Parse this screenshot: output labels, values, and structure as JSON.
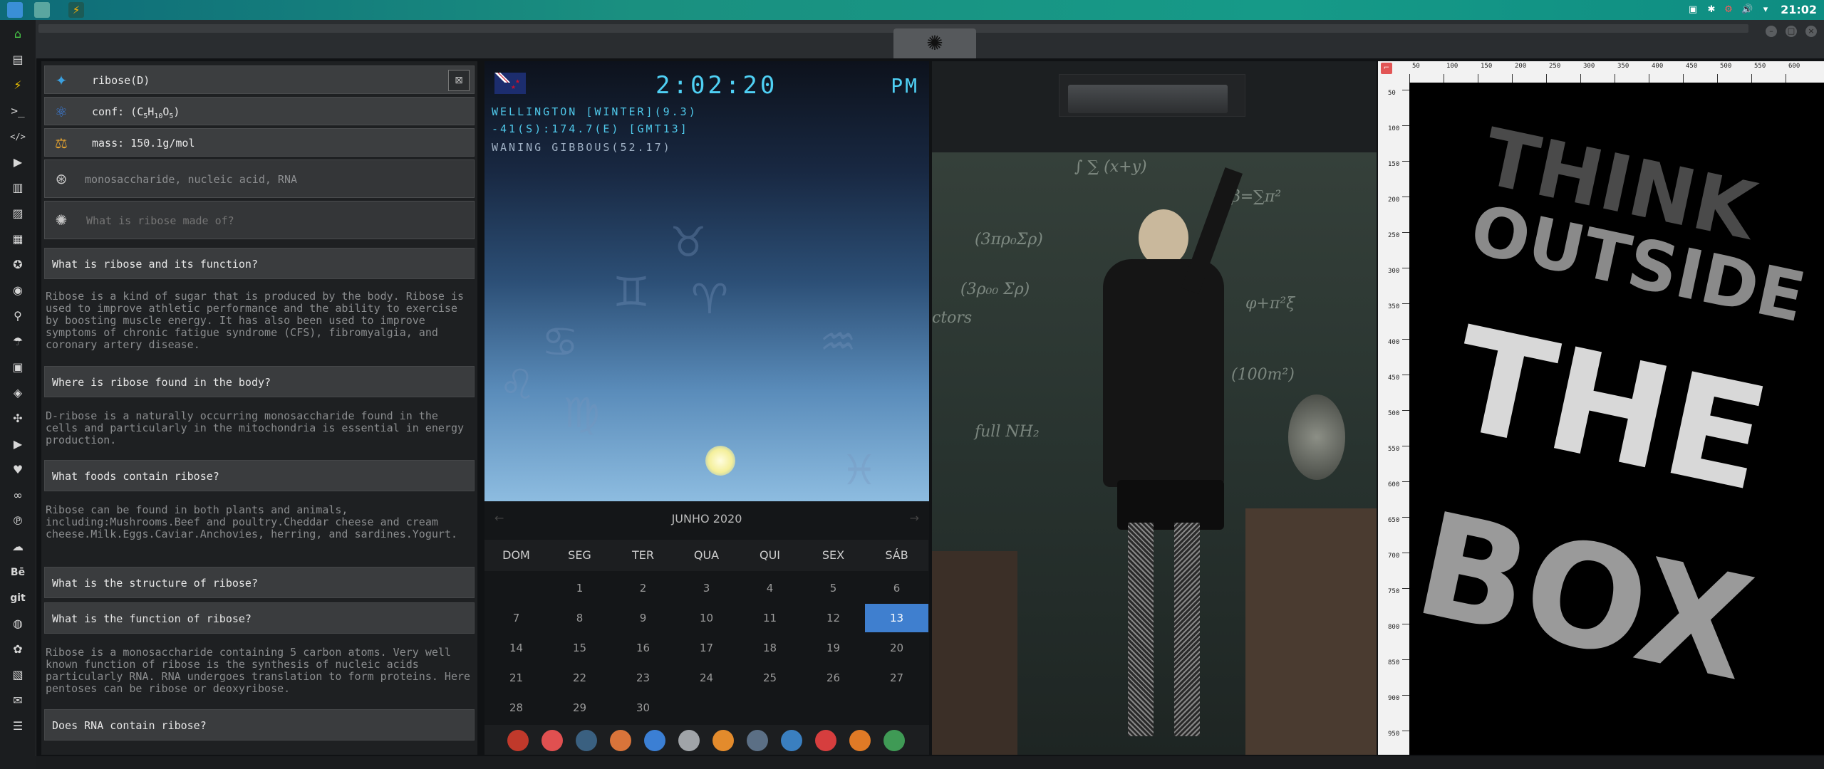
{
  "topbar": {
    "clock": "21:02",
    "apps": [
      "files-icon",
      "terminal-app-icon",
      "sublime-icon"
    ],
    "tray": [
      "screenshot-icon",
      "bluetooth-icon",
      "update-icon",
      "volume-icon",
      "wifi-icon"
    ]
  },
  "dock": {
    "items": [
      "home-icon",
      "document-icon",
      "bolt-icon",
      "terminal-icon",
      "code-icon",
      "play-icon",
      "book-icon",
      "image-icon",
      "calendar-icon",
      "compass-icon",
      "globe-icon",
      "search-icon",
      "umbrella-icon",
      "contact-icon",
      "tag-icon",
      "puzzle-icon",
      "youtube-icon",
      "heart-icon",
      "link-icon",
      "pinterest-icon",
      "cloud-icon",
      "behance-icon",
      "git-icon",
      "github-icon",
      "cube-icon",
      "map-icon",
      "mail-icon",
      "server-icon"
    ],
    "labels": {
      "behance": "Bē",
      "git": "git"
    }
  },
  "ribose": {
    "name": "ribose(D)",
    "conf": "conf: (C5H10O5)",
    "conf_parts": {
      "prefix": "conf: (C",
      "c": "5",
      "h": "H",
      "hn": "10",
      "o": "O",
      "on": "5",
      "suffix": ")"
    },
    "mass": "mass: 150.1g/mol",
    "tags": "monosaccharide, nucleic acid, RNA",
    "search_placeholder": "What is ribose made of?",
    "qa": [
      {
        "q": "What is ribose and its function?",
        "a": "Ribose is a kind of sugar that is produced by the body. Ribose is used to improve athletic performance and the ability to exercise by boosting muscle energy. It has also been used to improve symptoms of chronic fatigue syndrome (CFS), fibromyalgia, and coronary artery disease."
      },
      {
        "q": "Where is ribose found in the body?",
        "a": "D-ribose is a naturally occurring monosaccharide found in the cells and particularly in the mitochondria is essential in energy production."
      },
      {
        "q": "What foods contain ribose?",
        "a": "Ribose can be found in both plants and animals, including:Mushrooms.Beef and poultry.Cheddar cheese and cream cheese.Milk.Eggs.Caviar.Anchovies, herring, and sardines.Yogurt."
      },
      {
        "q": "What is the structure of ribose?",
        "a": ""
      },
      {
        "q": "What is the function of ribose?",
        "a": "Ribose is a monosaccharide containing 5 carbon atoms. Very well known function of ribose is the synthesis of nucleic acids particularly RNA. RNA undergoes translation to form proteins. Here pentoses can be ribose or deoxyribose."
      },
      {
        "q": "Does RNA contain ribose?",
        "a": ""
      }
    ]
  },
  "weather": {
    "time": "2:02:20",
    "ampm": "PM",
    "line1": "WELLINGTON [WINTER](9.3)",
    "line2": "-41(S):174.7(E) [GMT13]",
    "line3": "WANING GIBBOUS(52.17)"
  },
  "calendar": {
    "month": "JUNHO 2020",
    "prev": "←",
    "next": "→",
    "weekdays": [
      "DOM",
      "SEG",
      "TER",
      "QUA",
      "QUI",
      "SEX",
      "SÁB"
    ],
    "selected": "13",
    "weeks": [
      [
        "",
        "1",
        "2",
        "3",
        "4",
        "5",
        "6"
      ],
      [
        "7",
        "8",
        "9",
        "10",
        "11",
        "12",
        "13"
      ],
      [
        "14",
        "15",
        "16",
        "17",
        "18",
        "19",
        "20"
      ],
      [
        "21",
        "22",
        "23",
        "24",
        "25",
        "26",
        "27"
      ],
      [
        "28",
        "29",
        "30",
        "",
        "",
        "",
        ""
      ]
    ]
  },
  "bottomdock": {
    "apps": [
      {
        "name": "launcher-icon",
        "color": "#c0392b"
      },
      {
        "name": "hourglass-icon",
        "color": "#e05050"
      },
      {
        "name": "earth-icon",
        "color": "#3a6080"
      },
      {
        "name": "image-viewer-icon",
        "color": "#d9743a"
      },
      {
        "name": "translate-icon",
        "color": "#3b7fd4"
      },
      {
        "name": "news-icon",
        "color": "#a0a4a8"
      },
      {
        "name": "magnifier-icon",
        "color": "#e38b2c"
      },
      {
        "name": "clock-icon",
        "color": "#5b6f85"
      },
      {
        "name": "web-icon",
        "color": "#3a7fc0"
      },
      {
        "name": "calendar-app-icon",
        "color": "#d63e3e"
      },
      {
        "name": "prompt-icon",
        "color": "#e07a26"
      },
      {
        "name": "yandex-icon",
        "color": "#3f9a55"
      }
    ]
  },
  "poster": {
    "lines": [
      "THINK",
      "OUTSIDE",
      "THE",
      "BOX"
    ]
  },
  "ruler": {
    "h_ticks": [
      "50",
      "100",
      "150",
      "200",
      "250",
      "300",
      "350",
      "400",
      "450",
      "500",
      "550",
      "600"
    ],
    "v_ticks": [
      "50",
      "100",
      "150",
      "200",
      "250",
      "300",
      "350",
      "400",
      "450",
      "500",
      "550",
      "600",
      "650",
      "700",
      "750",
      "800",
      "850",
      "900",
      "950"
    ]
  }
}
